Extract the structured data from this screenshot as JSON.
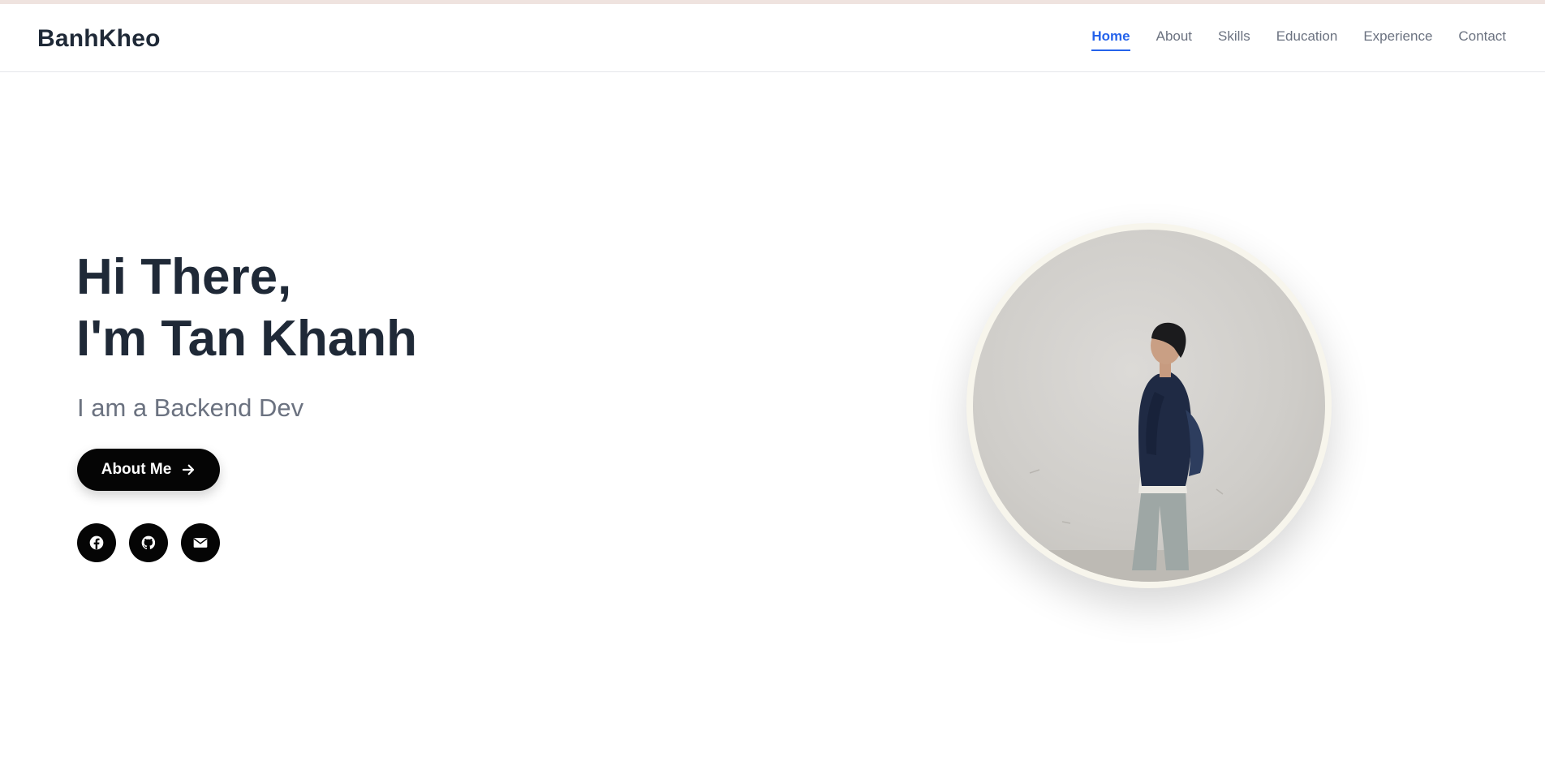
{
  "header": {
    "brand": "BanhKheo",
    "nav": [
      {
        "label": "Home",
        "active": true
      },
      {
        "label": "About",
        "active": false
      },
      {
        "label": "Skills",
        "active": false
      },
      {
        "label": "Education",
        "active": false
      },
      {
        "label": "Experience",
        "active": false
      },
      {
        "label": "Contact",
        "active": false
      }
    ]
  },
  "hero": {
    "greeting_line1": "Hi There,",
    "greeting_line2": "I'm Tan Khanh",
    "subtitle": "I am a Backend Dev",
    "cta_label": "About Me",
    "cta_icon": "arrow-right-icon",
    "socials": [
      {
        "icon": "facebook-icon"
      },
      {
        "icon": "github-icon"
      },
      {
        "icon": "mail-icon"
      }
    ]
  },
  "colors": {
    "accent": "#2563eb",
    "heading": "#1f2937",
    "muted": "#6b7280",
    "button": "#050505"
  }
}
